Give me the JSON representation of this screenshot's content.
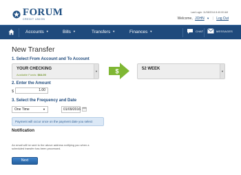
{
  "header": {
    "logo_name": "FORUM",
    "logo_sub": "CREDIT UNION",
    "last_login": "Last Login: 11/08/2014 8:40:00 AM",
    "welcome_label": "Welcome,",
    "username": "JOHN",
    "logout_label": "Log Out"
  },
  "nav": {
    "items": [
      {
        "label": "Accounts"
      },
      {
        "label": "Bills"
      },
      {
        "label": "Transfers"
      },
      {
        "label": "Finances"
      }
    ],
    "chat_label": "CHAT",
    "messages_label": "MESSAGES"
  },
  "page": {
    "title": "New Transfer",
    "step1_label": "1. Select From Account and To Account",
    "from_account": {
      "name": "YOUR CHECKING",
      "funds_label": "Available Funds:",
      "funds_value": "$64.00"
    },
    "arrow_symbol": "$",
    "to_account": {
      "name": "52 WEEK"
    },
    "step2_label": "2. Enter the Amount",
    "currency_symbol": "$",
    "amount_value": "1.00",
    "step3_label": "3. Select the Frequency and Date",
    "frequency_value": "One Time",
    "date_value": "01/09/2016",
    "info_message": "Payment will occur once on the payment date you select",
    "notification_title": "Notification",
    "notification_text": "An email will be sent to the above address notifying you when a scheduled transfer has been processed.",
    "next_label": "Next"
  },
  "colors": {
    "brand_blue": "#1f4a7c",
    "arrow_green": "#7fb734",
    "funds_green": "#6a8f1f",
    "info_bg": "#dbe8f6"
  }
}
